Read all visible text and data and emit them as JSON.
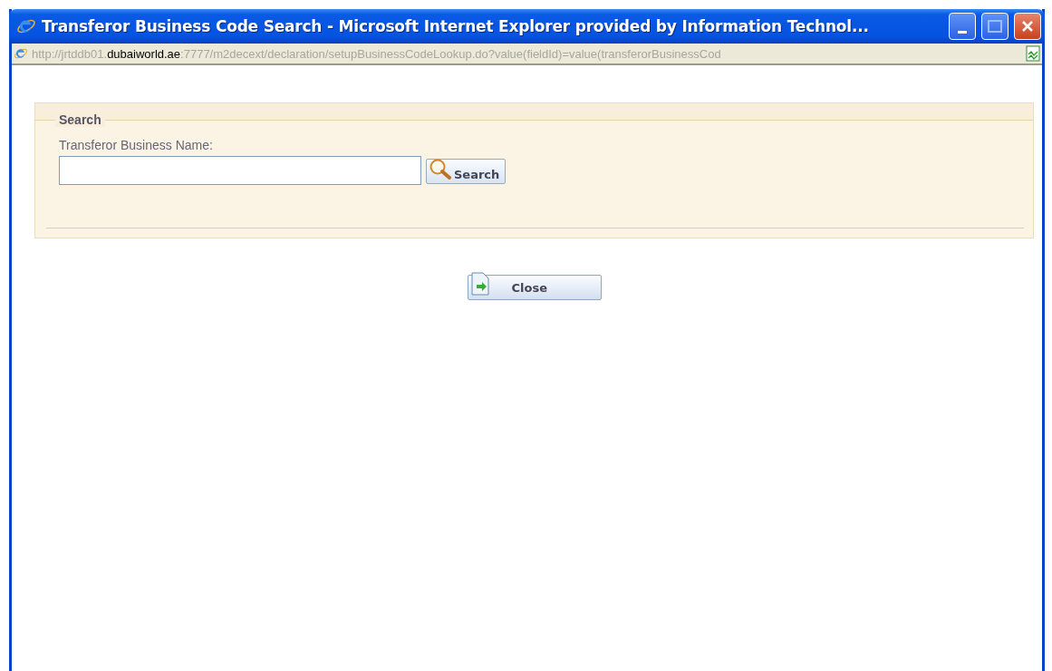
{
  "window": {
    "title": "Transferor Business Code Search - Microsoft Internet Explorer provided by Information Technol..."
  },
  "address_bar": {
    "url_parts": [
      {
        "text": "http://jrtddb01.",
        "highlighted": false
      },
      {
        "text": "dubaiworld.ae",
        "highlighted": true
      },
      {
        "text": ":7777/m2decext/declaration/setupBusinessCodeLookup.do?value(fieldId)=value(transferorBusinessCod",
        "highlighted": false
      }
    ]
  },
  "search_panel": {
    "legend": "Search",
    "field_label": "Transferor Business Name:",
    "search_button": "Search"
  },
  "close_button": "Close"
}
